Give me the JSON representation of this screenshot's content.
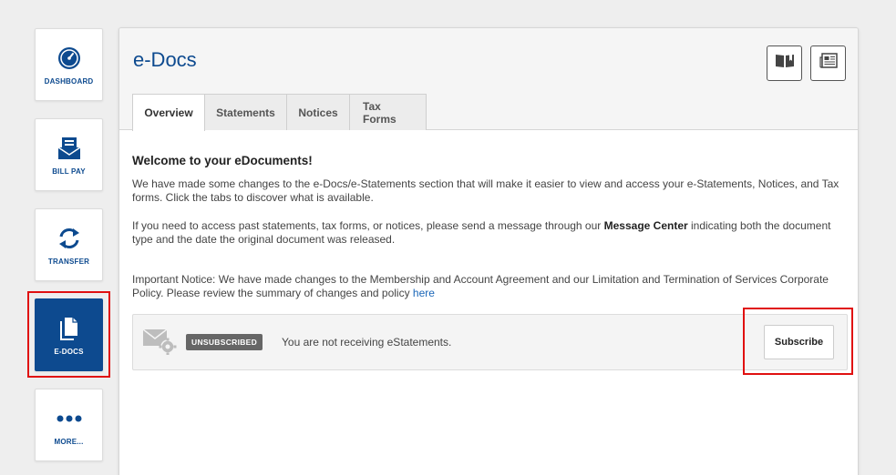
{
  "sidebar": {
    "items": [
      {
        "label": "DASHBOARD",
        "icon": "gauge-icon"
      },
      {
        "label": "BILL PAY",
        "icon": "bill-pay-icon"
      },
      {
        "label": "TRANSFER",
        "icon": "transfer-icon"
      },
      {
        "label": "E-DOCS",
        "icon": "document-icon",
        "active": true
      },
      {
        "label": "MORE...",
        "icon": "more-icon"
      }
    ]
  },
  "header": {
    "title": "e-Docs",
    "buttons": [
      {
        "icon": "book-icon"
      },
      {
        "icon": "newspaper-icon"
      }
    ]
  },
  "tabs": [
    {
      "label": "Overview",
      "active": true
    },
    {
      "label": "Statements"
    },
    {
      "label": "Notices"
    },
    {
      "label": "Tax Forms"
    }
  ],
  "content": {
    "welcome": "Welcome to your eDocuments!",
    "para1": "We have made some changes to the e-Docs/e-Statements section that will make it easier to view and access your e-Statements, Notices, and Tax forms. Click the tabs to discover what is available.",
    "para2_before": "If you need to access past statements, tax forms, or notices, please send a message through our ",
    "para2_bold": "Message Center",
    "para2_after": " indicating both the document type and the date the original document was released.",
    "notice_text": "Important Notice: We have made changes to the Membership and Account Agreement and our Limitation and Termination of Services Corporate Policy. Please review the summary of changes and policy ",
    "notice_link": "here"
  },
  "subscription": {
    "badge": "UNSUBSCRIBED",
    "message": "You are not receiving eStatements.",
    "button_label": "Subscribe"
  },
  "colors": {
    "brand": "#0d4a8f",
    "highlight": "#e01010"
  }
}
